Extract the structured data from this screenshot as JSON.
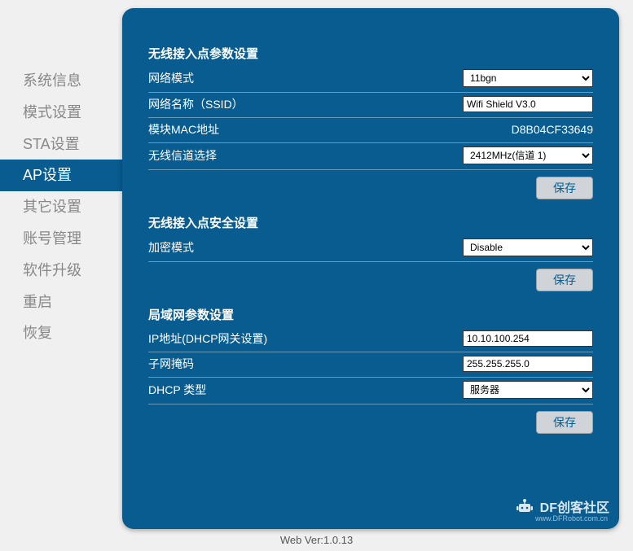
{
  "sidebar": {
    "items": [
      {
        "label": "系统信息"
      },
      {
        "label": "模式设置"
      },
      {
        "label": "STA设置"
      },
      {
        "label": "AP设置"
      },
      {
        "label": "其它设置"
      },
      {
        "label": "账号管理"
      },
      {
        "label": "软件升级"
      },
      {
        "label": "重启"
      },
      {
        "label": "恢复"
      }
    ],
    "activeIndex": 3
  },
  "sections": {
    "wireless": {
      "title": "无线接入点参数设置",
      "mode_label": "网络模式",
      "mode_value": "11bgn",
      "ssid_label": "网络名称（SSID）",
      "ssid_value": "Wifi Shield V3.0",
      "mac_label": "模块MAC地址",
      "mac_value": "D8B04CF33649",
      "channel_label": "无线信道选择",
      "channel_value": "2412MHz(信道 1)",
      "save": "保存"
    },
    "security": {
      "title": "无线接入点安全设置",
      "enc_label": "加密模式",
      "enc_value": "Disable",
      "save": "保存"
    },
    "lan": {
      "title": "局域网参数设置",
      "ip_label": "IP地址(DHCP网关设置)",
      "ip_value": "10.10.100.254",
      "mask_label": "子网掩码",
      "mask_value": "255.255.255.0",
      "dhcp_label": "DHCP 类型",
      "dhcp_value": "服务器",
      "save": "保存"
    }
  },
  "footer": {
    "version": "Web Ver:1.0.13"
  },
  "watermark": {
    "text": "DF创客社区",
    "url": "www.DFRobot.com.cn"
  }
}
